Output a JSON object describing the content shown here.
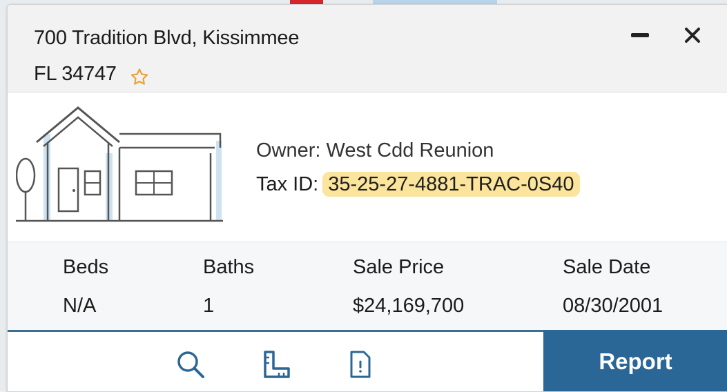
{
  "card": {
    "address_line1": "700 Tradition Blvd, Kissimmee",
    "address_line2": "FL 34747",
    "owner_label": "Owner:",
    "owner_name": "West Cdd Reunion",
    "tax_label": "Tax ID:",
    "tax_id": "35-25-27-4881-TRAC-0S40"
  },
  "stats": [
    {
      "label": "Beds",
      "value": "N/A"
    },
    {
      "label": "Baths",
      "value": "1"
    },
    {
      "label": "Sale Price",
      "value": "$24,169,700"
    },
    {
      "label": "Sale Date",
      "value": "08/30/2001"
    }
  ],
  "footer": {
    "report_label": "Report",
    "icons": [
      "search-icon",
      "ruler-icon",
      "document-icon"
    ]
  },
  "colors": {
    "accent": "#2a6796",
    "highlight": "#fbe49c",
    "star": "#e7a33e"
  }
}
